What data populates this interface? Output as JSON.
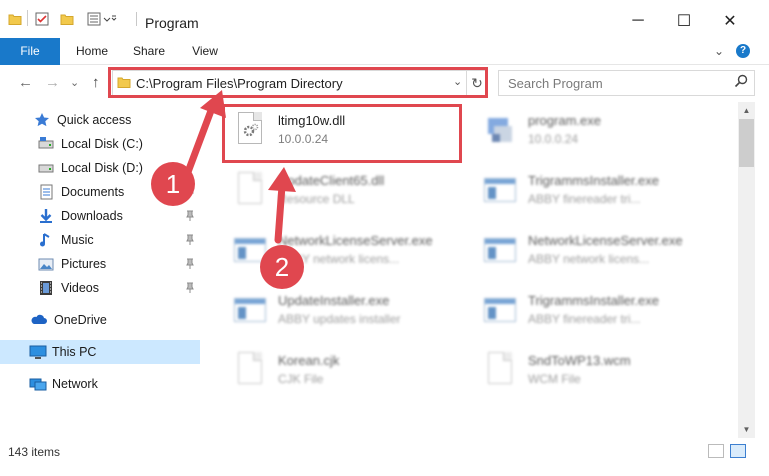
{
  "window": {
    "title": "Program",
    "minimize": "─",
    "maximize": "☐",
    "close": "✕"
  },
  "ribbon": {
    "tabs": [
      "File",
      "Home",
      "Share",
      "View"
    ],
    "expand": "⌄",
    "help": "?"
  },
  "nav": {
    "back": "←",
    "forward": "→",
    "recent": "⌄",
    "up": "↑",
    "address": "C:\\Program Files\\Program Directory",
    "address_dropdown": "⌄",
    "refresh": "↻",
    "search_placeholder": "Search Program",
    "search_icon": "⚲"
  },
  "sidebar": {
    "items": [
      {
        "label": "Quick access",
        "icon": "star-icon",
        "pinned": false
      },
      {
        "label": "Local Disk (C:)",
        "icon": "drive-icon",
        "pinned": false
      },
      {
        "label": "Local Disk (D:)",
        "icon": "drive-icon",
        "pinned": true
      },
      {
        "label": "Documents",
        "icon": "documents-icon",
        "pinned": true
      },
      {
        "label": "Downloads",
        "icon": "downloads-icon",
        "pinned": true
      },
      {
        "label": "Music",
        "icon": "music-icon",
        "pinned": true
      },
      {
        "label": "Pictures",
        "icon": "pictures-icon",
        "pinned": true
      },
      {
        "label": "Videos",
        "icon": "videos-icon",
        "pinned": true
      },
      {
        "label": "OneDrive",
        "icon": "onedrive-icon",
        "pinned": false
      },
      {
        "label": "This PC",
        "icon": "this-pc-icon",
        "pinned": false,
        "selected": true
      },
      {
        "label": "Network",
        "icon": "network-icon",
        "pinned": false
      }
    ],
    "pin_glyph": "⚲"
  },
  "files": [
    {
      "name": "ltimg10w.dll",
      "sub": "10.0.0.24",
      "icon": "dll-gear-icon",
      "highlighted": true
    },
    {
      "name": "program.exe",
      "sub": "10.0.0.24",
      "icon": "exe-icon",
      "highlighted": false
    },
    {
      "name": "UpdateClient65.dll",
      "sub": "Resource DLL",
      "icon": "dll-gear-icon",
      "highlighted": false
    },
    {
      "name": "TrigrammsInstaller.exe",
      "sub": "ABBY finereader tri...",
      "icon": "app-window-icon",
      "highlighted": false
    },
    {
      "name": "NetworkLicenseServer.exe",
      "sub": "ABBY network licens...",
      "icon": "app-window-icon",
      "highlighted": false
    },
    {
      "name": "NetworkLicenseServer.exe",
      "sub": "ABBY network licens...",
      "icon": "app-window-icon",
      "highlighted": false
    },
    {
      "name": "UpdateInstaller.exe",
      "sub": "ABBY updates installer",
      "icon": "app-window-icon",
      "highlighted": false
    },
    {
      "name": "TrigrammsInstaller.exe",
      "sub": "ABBY finereader tri...",
      "icon": "app-window-icon",
      "highlighted": false
    },
    {
      "name": "Korean.cjk",
      "sub": "CJK File",
      "icon": "blank-file-icon",
      "highlighted": false
    },
    {
      "name": "SndToWP13.wcm",
      "sub": "WCM File",
      "icon": "blank-file-icon",
      "highlighted": false
    }
  ],
  "status": {
    "count": "143 items"
  },
  "callouts": {
    "one": "1",
    "two": "2"
  },
  "colors": {
    "accent": "#1979ca",
    "highlight": "#e0474f",
    "selected": "#cce8ff"
  }
}
